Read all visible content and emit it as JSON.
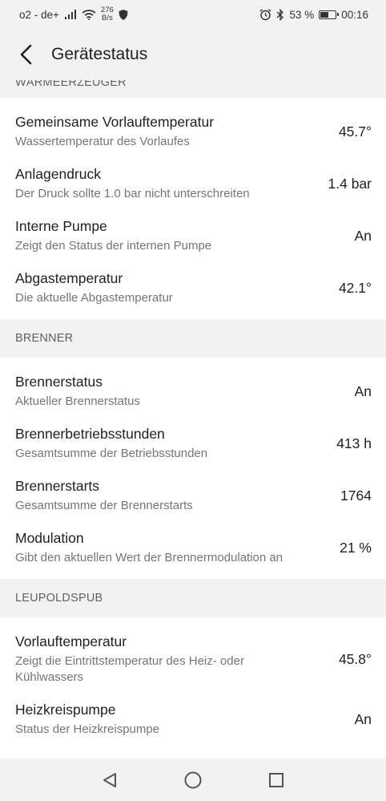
{
  "status_bar": {
    "carrier": "o2 - de+",
    "net_speed_value": "276",
    "net_speed_unit": "B/s",
    "battery": "53 %",
    "time": "00:16",
    "icons": [
      "signal-icon",
      "wifi-icon",
      "shield-icon",
      "alarm-icon",
      "bluetooth-icon",
      "battery-icon"
    ],
    "battery_level": 0.53
  },
  "appbar": {
    "title": "Gerätestatus",
    "back_icon": "back-arrow-icon"
  },
  "sections": {
    "waermeerzeuger": {
      "header": "WÄRMEERZEUGER",
      "rows": [
        {
          "label": "Gemeinsame Vorlauftemperatur",
          "desc": "Wassertemperatur des Vorlaufes",
          "value": "45.7°"
        },
        {
          "label": "Anlagendruck",
          "desc": "Der Druck sollte 1.0 bar nicht unterschreiten",
          "value": "1.4 bar"
        },
        {
          "label": "Interne Pumpe",
          "desc": "Zeigt den Status der internen Pumpe",
          "value": "An"
        },
        {
          "label": "Abgastemperatur",
          "desc": "Die aktuelle Abgastemperatur",
          "value": "42.1°"
        }
      ]
    },
    "brenner": {
      "header": "BRENNER",
      "rows": [
        {
          "label": "Brennerstatus",
          "desc": "Aktueller Brennerstatus",
          "value": "An"
        },
        {
          "label": "Brennerbetriebsstunden",
          "desc": "Gesamtsumme der Betriebsstunden",
          "value": "413 h"
        },
        {
          "label": "Brennerstarts",
          "desc": "Gesamtsumme der Brennerstarts",
          "value": "1764"
        },
        {
          "label": "Modulation",
          "desc": "Gibt den aktuellen Wert der Brennermodulation an",
          "value": "21 %"
        }
      ]
    },
    "leupoldspub": {
      "header": "LEUPOLDSPUB",
      "rows": [
        {
          "label": "Vorlauftemperatur",
          "desc": "Zeigt die Eintrittstemperatur des Heiz- oder Kühlwassers",
          "value": "45.8°"
        },
        {
          "label": "Heizkreispumpe",
          "desc": "Status der Heizkreispumpe",
          "value": "An"
        }
      ]
    }
  },
  "navbar": {
    "icons": [
      "back-triangle-icon",
      "home-circle-icon",
      "recents-square-icon"
    ]
  }
}
